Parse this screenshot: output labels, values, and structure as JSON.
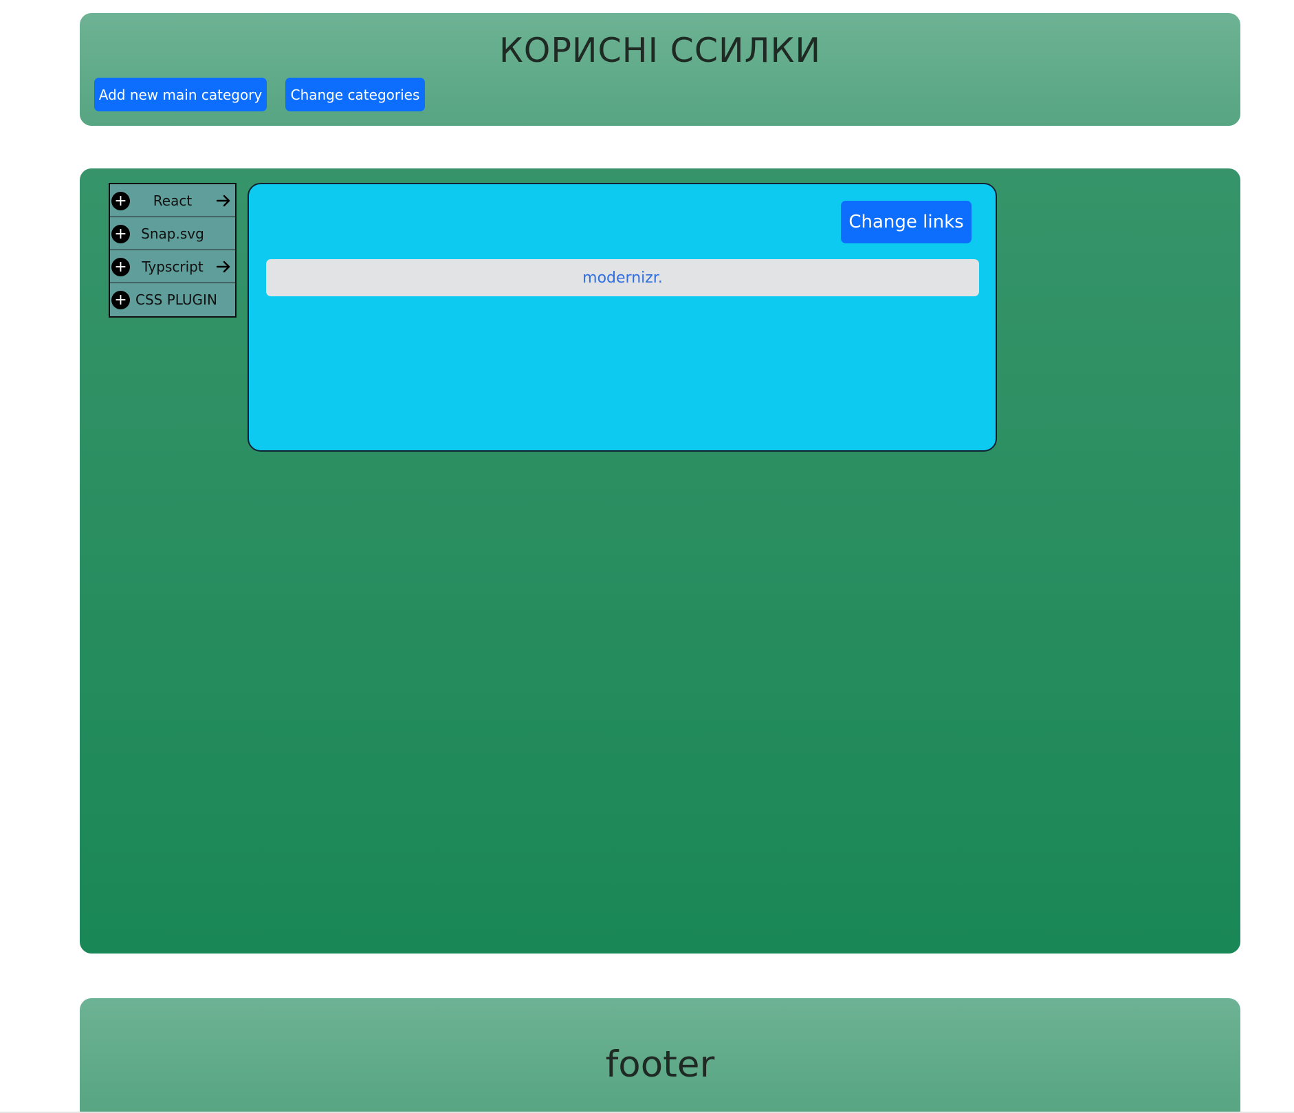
{
  "header": {
    "title": "КОРИСНІ ССИЛКИ",
    "add_category_label": "Add new main category",
    "change_categories_label": "Change categories"
  },
  "sidebar": {
    "items": [
      {
        "label": "React",
        "has_arrow": true
      },
      {
        "label": "Snap.svg",
        "has_arrow": false
      },
      {
        "label": "Typscript",
        "has_arrow": true
      },
      {
        "label": "CSS PLUGIN",
        "has_arrow": false
      }
    ],
    "add_icon": "plus-circle-icon",
    "expand_icon": "arrow-right-icon"
  },
  "panel": {
    "change_links_label": "Change links",
    "links": [
      {
        "label": "modernizr."
      }
    ]
  },
  "footer": {
    "text": "footer"
  },
  "colors": {
    "primary_button": "#0d6efd",
    "panel_background": "#0dcaf0",
    "link_item_background": "#e2e3e5",
    "link_text": "#2f6fe0",
    "main_top": "#37946a",
    "main_bottom": "#1a8756",
    "header_top": "#6db294",
    "header_bottom": "#57a582",
    "sidebar_background": "#5f9e9a"
  }
}
